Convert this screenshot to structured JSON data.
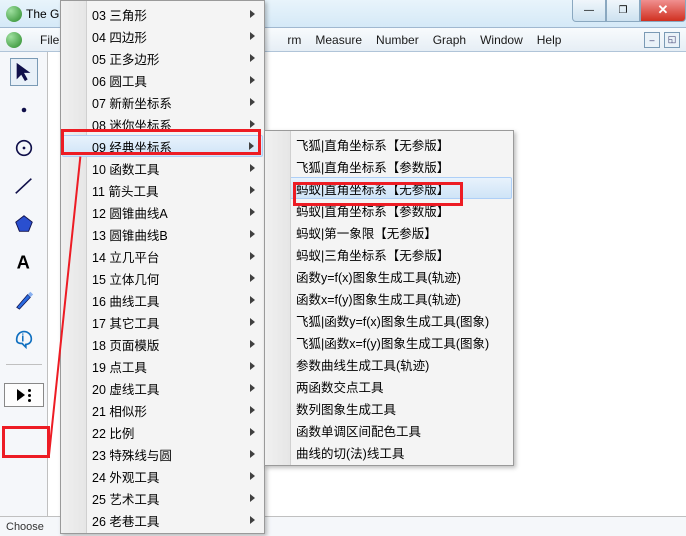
{
  "title": "The G",
  "menubar": [
    "File",
    "rm",
    "Measure",
    "Number",
    "Graph",
    "Window",
    "Help"
  ],
  "dropdown": [
    {
      "label": "03 三角形"
    },
    {
      "label": "04 四边形"
    },
    {
      "label": "05 正多边形"
    },
    {
      "label": "06 圆工具"
    },
    {
      "label": "07 新新坐标系"
    },
    {
      "label": "08 迷你坐标系"
    },
    {
      "label": "09 经典坐标系",
      "hover": true
    },
    {
      "label": "10 函数工具"
    },
    {
      "label": "11 箭头工具"
    },
    {
      "label": "12 圆锥曲线A"
    },
    {
      "label": "13 圆锥曲线B"
    },
    {
      "label": "14 立几平台"
    },
    {
      "label": "15 立体几何"
    },
    {
      "label": "16 曲线工具"
    },
    {
      "label": "17 其它工具"
    },
    {
      "label": "18 页面模版"
    },
    {
      "label": "19 点工具"
    },
    {
      "label": "20 虚线工具"
    },
    {
      "label": "21 相似形"
    },
    {
      "label": "22 比例"
    },
    {
      "label": "23 特殊线与圆"
    },
    {
      "label": "24 外观工具"
    },
    {
      "label": "25 艺术工具"
    },
    {
      "label": "26 老巷工具"
    }
  ],
  "submenu": [
    {
      "label": "飞狐|直角坐标系【无参版】"
    },
    {
      "label": "飞狐|直角坐标系【参数版】"
    },
    {
      "label": "蚂蚁|直角坐标系【无参版】",
      "hover": true
    },
    {
      "label": "蚂蚁|直角坐标系【参数版】"
    },
    {
      "label": "蚂蚁|第一象限【无参版】"
    },
    {
      "label": "蚂蚁|三角坐标系【无参版】"
    },
    {
      "label": "函数y=f(x)图象生成工具(轨迹)"
    },
    {
      "label": "函数x=f(y)图象生成工具(轨迹)"
    },
    {
      "label": "飞狐|函数y=f(x)图象生成工具(图象)"
    },
    {
      "label": "飞狐|函数x=f(y)图象生成工具(图象)"
    },
    {
      "label": "参数曲线生成工具(轨迹)"
    },
    {
      "label": "两函数交点工具"
    },
    {
      "label": "数列图象生成工具"
    },
    {
      "label": "函数单调区间配色工具"
    },
    {
      "label": "曲线的切(法)线工具"
    }
  ],
  "status": "Choose",
  "tool_names": {
    "arrow": "arrow-tool",
    "point": "point-tool",
    "circle": "circle-tool",
    "line": "line-tool",
    "polygon": "polygon-tool",
    "text": "text-tool",
    "marker": "marker-tool",
    "info": "info-tool"
  }
}
